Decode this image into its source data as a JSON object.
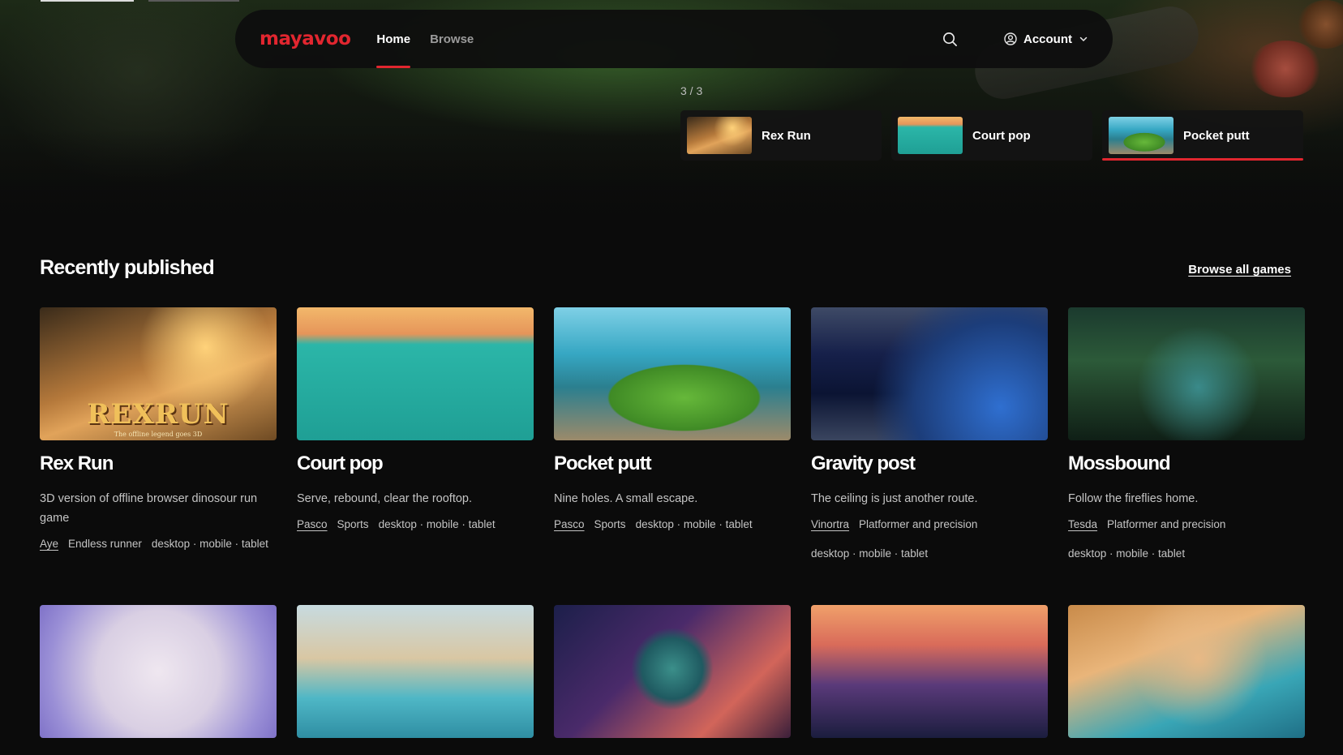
{
  "app": {
    "logo": "mayavoo"
  },
  "nav": {
    "links": [
      {
        "label": "Home",
        "active": true
      },
      {
        "label": "Browse",
        "active": false
      }
    ],
    "account_label": "Account",
    "accent_color": "#e1262f"
  },
  "hero": {
    "counter": "3 / 3",
    "slides": [
      {
        "label": "Rex Run",
        "art": "art-rex"
      },
      {
        "label": "Court pop",
        "art": "art-court"
      },
      {
        "label": "Pocket putt",
        "art": "art-putt",
        "active": true
      }
    ]
  },
  "section": {
    "title": "Recently published",
    "browse_all": "Browse all games"
  },
  "games": [
    {
      "title": "Rex Run",
      "art": "art-rex",
      "art_text": "REXRUN",
      "art_subtext": "The offline legend goes 3D",
      "description": "3D version of offline browser dinosour run game",
      "author": "Aye",
      "genre": "Endless runner",
      "platforms": "desktop · mobile · tablet"
    },
    {
      "title": "Court pop",
      "art": "art-court",
      "description": "Serve, rebound, clear the rooftop.",
      "author": "Pasco",
      "genre": "Sports",
      "platforms": "desktop · mobile · tablet"
    },
    {
      "title": "Pocket putt",
      "art": "art-putt",
      "description": "Nine holes. A small escape.",
      "author": "Pasco",
      "genre": "Sports",
      "platforms": "desktop · mobile · tablet"
    },
    {
      "title": "Gravity post",
      "art": "art-gravity",
      "description": "The ceiling is just another route.",
      "author": "Vinortra",
      "genre": "Platformer and precision",
      "platforms": "desktop · mobile · tablet"
    },
    {
      "title": "Mossbound",
      "art": "art-moss",
      "description": "Follow the fireflies home.",
      "author": "Tesda",
      "genre": "Platformer and precision",
      "platforms": "desktop · mobile · tablet"
    }
  ],
  "games_row2": [
    {
      "art": "art-beam"
    },
    {
      "art": "art-marble"
    },
    {
      "art": "art-orbit"
    },
    {
      "art": "art-tower"
    },
    {
      "art": "art-paper"
    }
  ]
}
